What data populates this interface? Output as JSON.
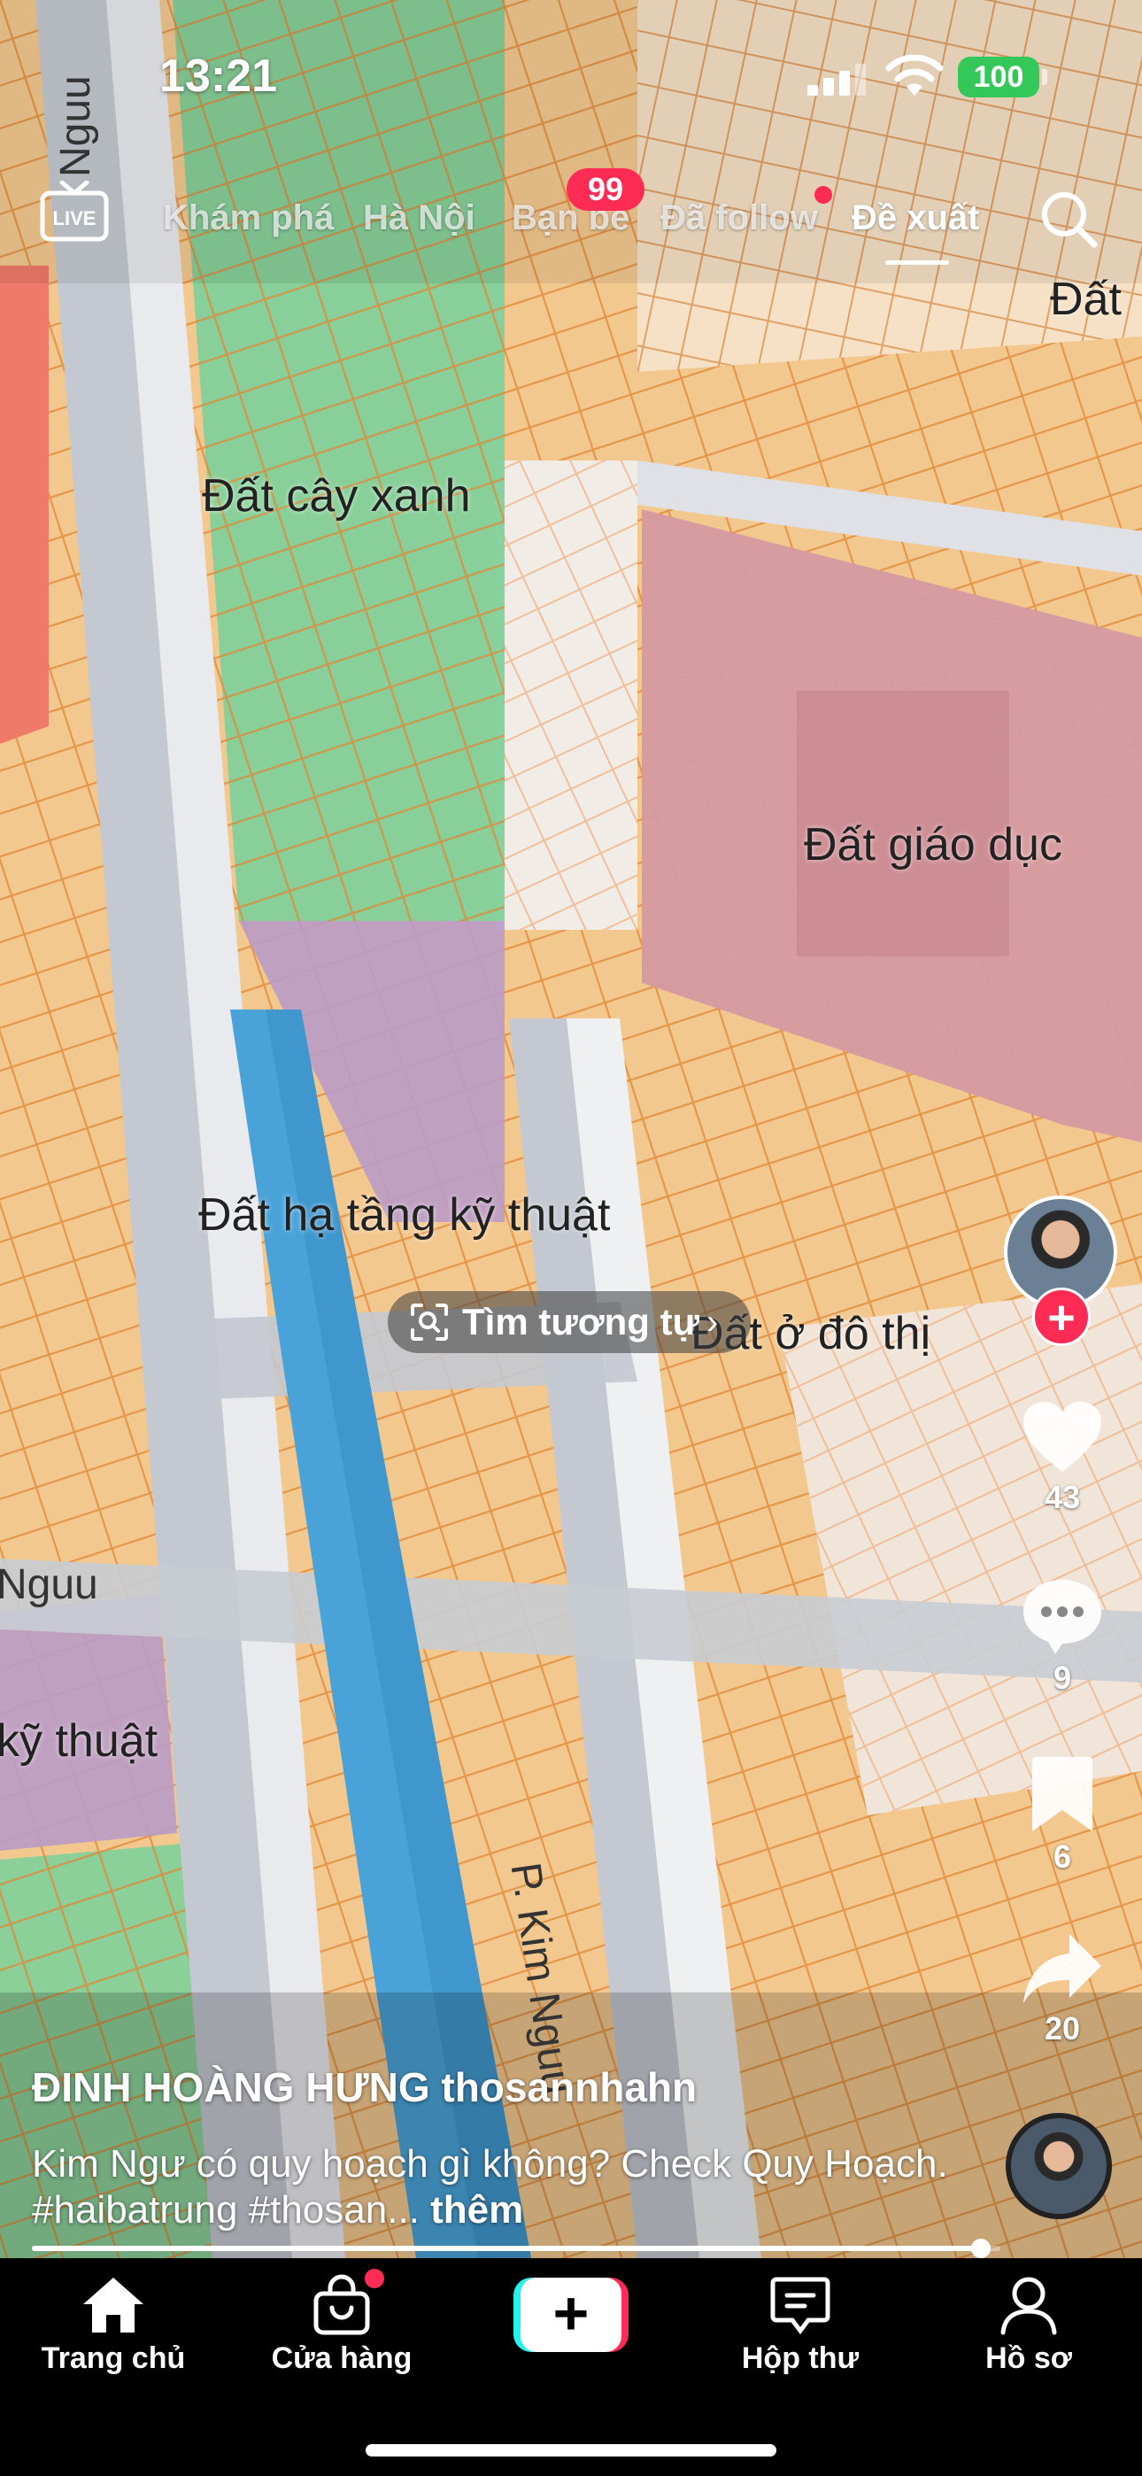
{
  "status_bar": {
    "time": "13:21",
    "battery": "100"
  },
  "top_nav": {
    "tabs": [
      {
        "label": "Khám phá"
      },
      {
        "label": "Hà Nội"
      },
      {
        "label": "Bạn bè"
      },
      {
        "label": "Đã follow"
      },
      {
        "label": "Đề xuất"
      }
    ],
    "friends_badge": "99",
    "active_tab": "Đề xuất"
  },
  "map": {
    "labels": {
      "cay_xanh": "Đất cây xanh",
      "giao_duc": "Đất giáo dục",
      "ha_tang": "Đất hạ tầng kỹ thuật",
      "o_do_thi": "Đất ở đô thị",
      "dat_top": "Đất",
      "ky_thuat_left": "kỹ thuật",
      "nguu_left": "Nguu",
      "road_kim_nguu": "P. Kim Nguu",
      "road_top": "Nguu"
    }
  },
  "visual_search": {
    "label": "Tìm tương tự"
  },
  "rail": {
    "likes": "43",
    "comments": "9",
    "saves": "6",
    "shares": "20"
  },
  "caption": {
    "author": "ĐINH HOÀNG HƯNG thosannhahn",
    "description": "Kim Ngư có quy hoạch gì không? Check Quy Hoạch. #haibatrung #thosan...",
    "more": "thêm"
  },
  "progress": {
    "fraction": 0.98
  },
  "bottom_nav": {
    "items": [
      {
        "label": "Trang chủ"
      },
      {
        "label": "Cửa hàng"
      },
      {
        "label": "Hộp thư"
      },
      {
        "label": "Hồ sơ"
      }
    ]
  },
  "colors": {
    "accent": "#fe2c55",
    "cyan": "#25f4ee",
    "battery": "#34c759",
    "zone_green": "#7fcf9a",
    "zone_pink": "#d59aa0",
    "zone_orange": "#f3c88f",
    "zone_purple": "#b99bc6",
    "canal": "#4aa3d8"
  }
}
